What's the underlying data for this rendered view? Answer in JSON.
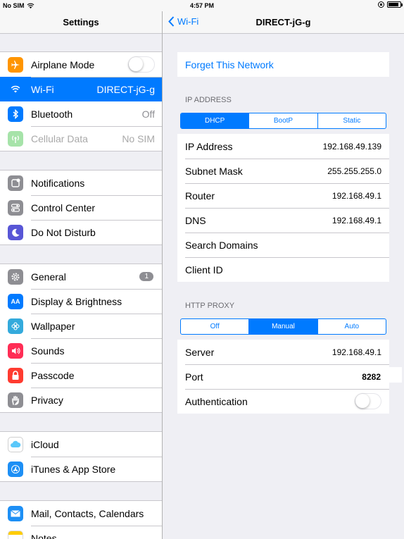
{
  "status_bar": {
    "carrier": "No SIM",
    "time": "4:57 PM"
  },
  "left": {
    "title": "Settings",
    "groups": [
      [
        {
          "label": "Airplane Mode",
          "icon": "airplane-icon",
          "color": "#ff9500"
        },
        {
          "label": "Wi-Fi",
          "value": "DIRECT-jG-g",
          "icon": "wifi-icon",
          "color": "#007aff"
        },
        {
          "label": "Bluetooth",
          "value": "Off",
          "icon": "bluetooth-icon",
          "color": "#007aff"
        },
        {
          "label": "Cellular Data",
          "value": "No SIM",
          "icon": "cellular-icon",
          "color": "#a6e3a9"
        }
      ],
      [
        {
          "label": "Notifications",
          "icon": "notifications-icon",
          "color": "#8e8e93"
        },
        {
          "label": "Control Center",
          "icon": "control-center-icon",
          "color": "#8e8e93"
        },
        {
          "label": "Do Not Disturb",
          "icon": "moon-icon",
          "color": "#5856d6"
        }
      ],
      [
        {
          "label": "General",
          "badge": "1",
          "icon": "gear-icon",
          "color": "#8e8e93"
        },
        {
          "label": "Display & Brightness",
          "icon": "display-icon",
          "color": "#007aff",
          "glyph": "AA"
        },
        {
          "label": "Wallpaper",
          "icon": "wallpaper-icon",
          "color": "#34aadc"
        },
        {
          "label": "Sounds",
          "icon": "speaker-icon",
          "color": "#ff2d55"
        },
        {
          "label": "Passcode",
          "icon": "lock-icon",
          "color": "#ff3b30"
        },
        {
          "label": "Privacy",
          "icon": "hand-icon",
          "color": "#8e8e93"
        }
      ],
      [
        {
          "label": "iCloud",
          "icon": "cloud-icon",
          "color": "#ffffff"
        },
        {
          "label": "iTunes & App Store",
          "icon": "app-store-icon",
          "color": "#1d8ff5"
        }
      ],
      [
        {
          "label": "Mail, Contacts, Calendars",
          "icon": "mail-icon",
          "color": "#1d8ff5"
        },
        {
          "label": "Notes",
          "icon": "notes-icon",
          "color": "#ffcc00"
        }
      ]
    ]
  },
  "right": {
    "back_label": "Wi-Fi",
    "title": "DIRECT-jG-g",
    "forget": "Forget This Network",
    "ip_header": "IP ADDRESS",
    "ip_modes": [
      "DHCP",
      "BootP",
      "Static"
    ],
    "ip_rows": [
      {
        "label": "IP Address",
        "value": "192.168.49.139"
      },
      {
        "label": "Subnet Mask",
        "value": "255.255.255.0"
      },
      {
        "label": "Router",
        "value": "192.168.49.1"
      },
      {
        "label": "DNS",
        "value": "192.168.49.1"
      },
      {
        "label": "Search Domains",
        "value": ""
      },
      {
        "label": "Client ID",
        "value": ""
      }
    ],
    "proxy_header": "HTTP PROXY",
    "proxy_modes": [
      "Off",
      "Manual",
      "Auto"
    ],
    "server_label": "Server",
    "server_value": "192.168.49.1",
    "port_label": "Port",
    "port_value": "8282",
    "auth_label": "Authentication"
  }
}
